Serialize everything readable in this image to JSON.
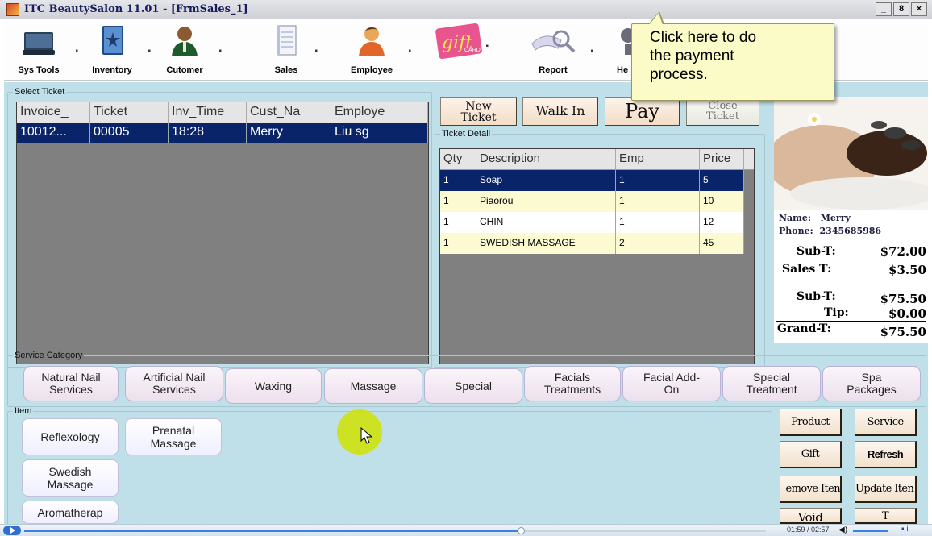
{
  "window": {
    "title": "ITC BeautySalon 11.01 - [FrmSales_1]",
    "controls": [
      "_",
      "8",
      "×"
    ]
  },
  "toolbar": {
    "items": [
      {
        "label": "Sys Tools",
        "icon": "monitor-icon",
        "has_dropdown": true
      },
      {
        "label": "Inventory",
        "icon": "inventory-book-icon",
        "has_dropdown": true
      },
      {
        "label": "Cutomer",
        "icon": "customer-person-icon",
        "has_dropdown": true
      },
      {
        "label": "Sales",
        "icon": "sales-document-icon",
        "has_dropdown": true
      },
      {
        "label": "Employee",
        "icon": "employee-person-icon",
        "has_dropdown": true
      },
      {
        "label": "",
        "icon": "gift-card-icon",
        "has_dropdown": true
      },
      {
        "label": "Report",
        "icon": "report-magnifier-icon",
        "has_dropdown": true
      },
      {
        "label": "He",
        "icon": "help-icon",
        "has_dropdown": false
      }
    ],
    "gift_card_text": "gift",
    "gift_card_subtext": "CARD"
  },
  "tooltip": {
    "text_lines": [
      "Click here to do",
      "the payment",
      "process."
    ]
  },
  "select_ticket": {
    "legend": "Select Ticket",
    "columns": [
      "Invoice_",
      "Ticket",
      "Inv_Time",
      "Cust_Na",
      "Employe"
    ],
    "rows": [
      {
        "cells": [
          "10012...",
          "00005",
          "18:28",
          "Merry",
          "Liu sg"
        ],
        "selected": true
      }
    ]
  },
  "actions": {
    "new_ticket": [
      "New",
      "Ticket"
    ],
    "walk_in": "Walk In",
    "pay": "Pay",
    "close_ticket": [
      "Close",
      "Ticket"
    ]
  },
  "ticket_detail": {
    "legend": "Ticket Detail",
    "columns": [
      "Qty",
      "Description",
      "Emp",
      "Price"
    ],
    "rows": [
      {
        "cells": [
          "1",
          "Soap",
          "1",
          "5"
        ],
        "style": "selected"
      },
      {
        "cells": [
          "1",
          "Piaorou",
          "1",
          "10"
        ],
        "style": "yellow"
      },
      {
        "cells": [
          "1",
          "CHIN",
          "1",
          "12"
        ],
        "style": "white"
      },
      {
        "cells": [
          "1",
          "SWEDISH MASSAGE",
          "2",
          "45"
        ],
        "style": "yellow"
      }
    ]
  },
  "customer": {
    "name_label": "Name:",
    "name": "Merry",
    "phone_label": "Phone:",
    "phone": "2345685986",
    "subtotal1_label": "Sub-T:",
    "subtotal1": "$72.00",
    "sales_tax_label": "Sales T:",
    "sales_tax": "$3.50",
    "subtotal2_label": "Sub-T:",
    "subtotal2": "$75.50",
    "tip_label": "Tip:",
    "tip": "$0.00",
    "grand_total_label": "Grand-T:",
    "grand_total": "$75.50"
  },
  "service_category": {
    "legend": "Service Category",
    "items": [
      [
        "Natural Nail",
        "Services"
      ],
      [
        "Artificial Nail",
        "Services"
      ],
      [
        "Waxing"
      ],
      [
        "Massage"
      ],
      [
        "Special"
      ],
      [
        "Facials",
        "Treatments"
      ],
      [
        "Facial Add-",
        "On"
      ],
      [
        "Special",
        "Treatment"
      ],
      [
        "Spa",
        "Packages"
      ]
    ]
  },
  "item_panel": {
    "legend": "Item",
    "items": [
      [
        "Reflexology"
      ],
      [
        "Prenatal",
        "Massage"
      ],
      [
        "Swedish",
        "Massage"
      ],
      [
        "Aromatherap",
        ""
      ]
    ]
  },
  "side_actions": {
    "product": "Product",
    "service": "Service",
    "gift": "Gift",
    "refresh": "Refresh",
    "remove_item": "emove Iten",
    "update_item": "Update Iten",
    "void": "Void",
    "extra": "T"
  },
  "video": {
    "time": "01:59 / 02:57",
    "progress": 0.67
  }
}
